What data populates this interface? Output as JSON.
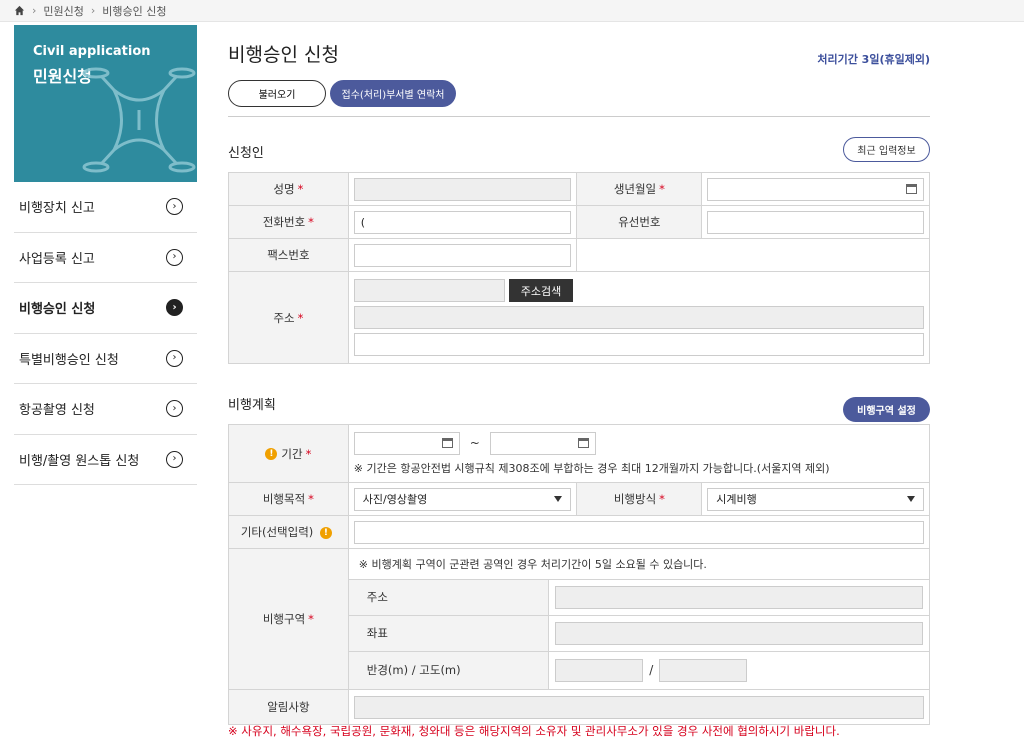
{
  "breadcrumb": {
    "items": [
      "민원신청",
      "비행승인 신청"
    ]
  },
  "sidebar": {
    "banner_en": "Civil application",
    "banner_ko": "민원신청",
    "items": [
      {
        "label": "비행장치 신고"
      },
      {
        "label": "사업등록 신고"
      },
      {
        "label": "비행승인 신청"
      },
      {
        "label": "특별비행승인 신청"
      },
      {
        "label": "항공촬영 신청"
      },
      {
        "label": "비행/촬영 원스톱 신청"
      }
    ]
  },
  "main": {
    "title": "비행승인 신청",
    "period": "처리기간 3일(휴일제외)",
    "load_button": "불러오기",
    "contact_button": "접수(처리)부서별 연락처"
  },
  "applicant": {
    "title": "신청인",
    "recent_button": "최근 입력정보",
    "name_label": "성명",
    "name_value": "",
    "birth_label": "생년월일",
    "phone_label": "전화번호",
    "phone_value": "(",
    "landline_label": "유선번호",
    "fax_label": "팩스번호",
    "address_label": "주소",
    "address_search_button": "주소검색"
  },
  "plan": {
    "title": "비행계획",
    "area_button": "비행구역 설정",
    "period_label": "기간",
    "period_tilde": "~",
    "period_note": "※ 기간은 항공안전법 시행규칙 제308조에 부합하는 경우 최대 12개월까지 가능합니다.(서울지역 제외)",
    "purpose_label": "비행목적",
    "purpose_value": "사진/영상촬영",
    "method_label": "비행방식",
    "method_value": "시계비행",
    "etc_label": "기타(선택입력)",
    "zone_label": "비행구역",
    "zone_note": "※ 비행계획 구역이 군관련 공역인 경우 처리기간이 5일 소요될 수 있습니다.",
    "zone_address": "주소",
    "zone_coord": "좌표",
    "zone_radius": "반경(m) / 고도(m)",
    "zone_slash": "/",
    "notice_label": "알림사항",
    "footnote": "※ 사유지, 해수욕장, 국립공원, 문화재, 청와대 등은 해당지역의 소유자 및 관리사무소가 있을 경우 사전에 협의하시기 바랍니다."
  }
}
